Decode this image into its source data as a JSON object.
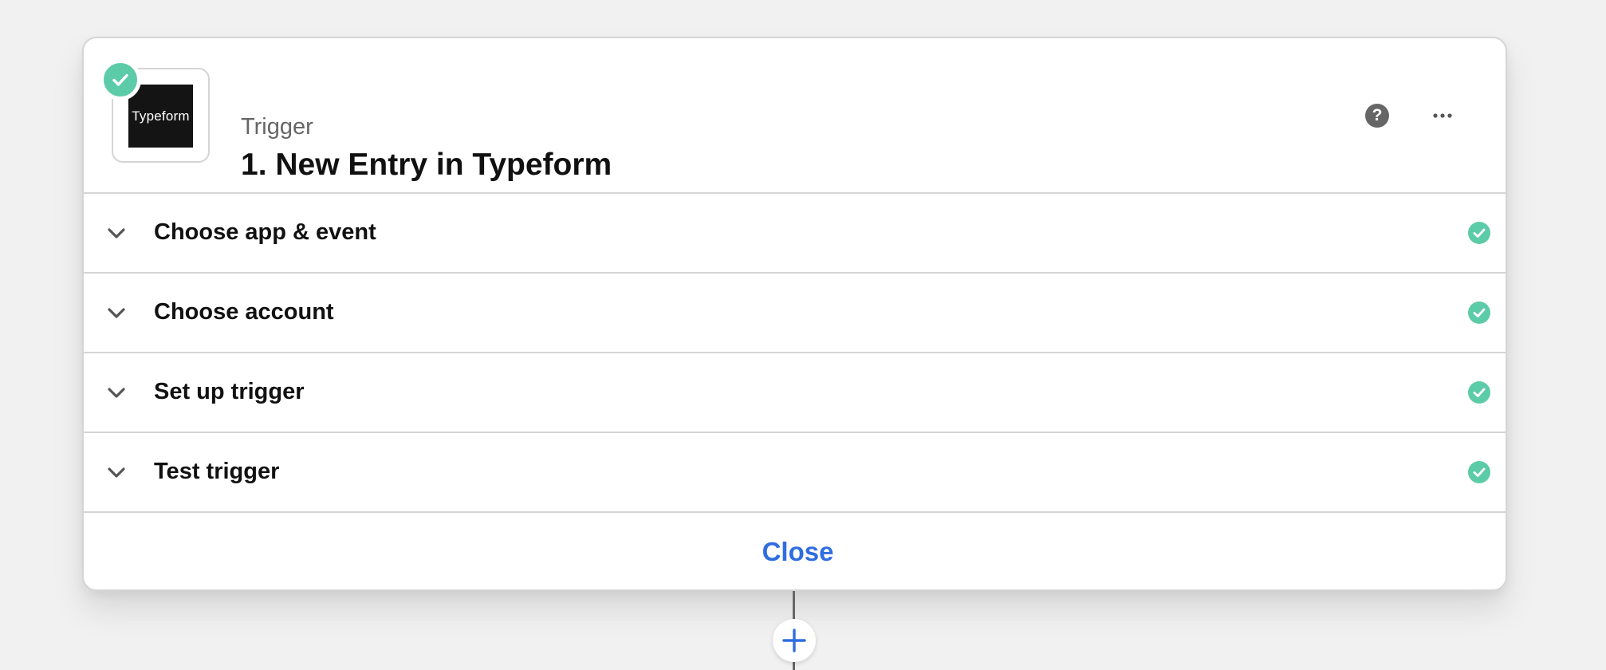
{
  "step": {
    "kicker": "Trigger",
    "title": "1. New Entry in Typeform",
    "app_logo_text": "Typeform",
    "help_symbol": "?",
    "status": "complete"
  },
  "sections": [
    {
      "label": "Choose app & event",
      "status": "complete"
    },
    {
      "label": "Choose account",
      "status": "complete"
    },
    {
      "label": "Set up trigger",
      "status": "complete"
    },
    {
      "label": "Test trigger",
      "status": "complete"
    }
  ],
  "footer": {
    "close_label": "Close"
  },
  "icons": {
    "status": "check-circle-icon",
    "help": "question-circle-icon",
    "more": "ellipsis-icon",
    "expand": "chevron-down-icon",
    "add": "plus-icon"
  },
  "colors": {
    "success": "#5ccba7",
    "link": "#2f6de0",
    "logo_bg": "#141414"
  }
}
